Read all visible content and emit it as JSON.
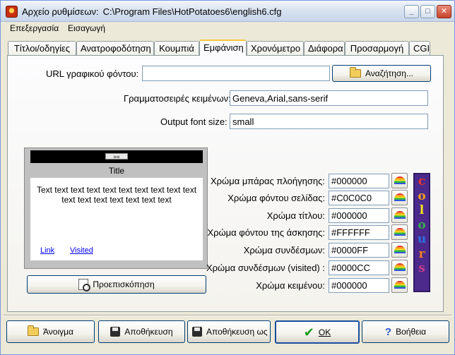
{
  "window": {
    "title": "Αρχείο ρυθμίσεων:",
    "path": "C:\\Program Files\\HotPotatoes6\\english6.cfg"
  },
  "menu": [
    "Επεξεργασία",
    "Εισαγωγή"
  ],
  "tabs": [
    {
      "label": "Τίτλοι/οδηγίες"
    },
    {
      "label": "Ανατροφοδότηση"
    },
    {
      "label": "Κουμπιά"
    },
    {
      "label": "Εμφάνιση",
      "active": true
    },
    {
      "label": "Χρονόμετρο"
    },
    {
      "label": "Διάφορα"
    },
    {
      "label": "Προσαρμογή"
    },
    {
      "label": "CGI"
    }
  ],
  "appearance": {
    "bg_url_label": "URL γραφικού φόντου:",
    "bg_url_value": "",
    "browse_label": "Αναζήτηση...",
    "fonts_label": "Γραμματοσειρές κειμένων:",
    "fonts_value": "Geneva,Arial,sans-serif",
    "font_size_label": "Output font size:",
    "font_size_value": "small"
  },
  "preview": {
    "nav_button": "==",
    "title": "Title",
    "text": "Text text text text text text text text text text text text text text text text text",
    "link": "Link",
    "visited": "Visited",
    "button_label": "Προεπισκόπηση"
  },
  "colours": [
    {
      "label": "Χρώμα μπάρας πλοήγησης:",
      "value": "#000000"
    },
    {
      "label": "Χρώμα φόντου σελίδας:",
      "value": "#C0C0C0"
    },
    {
      "label": "Χρώμα τίτλου:",
      "value": "#000000"
    },
    {
      "label": "Χρώμα φόντου της άσκησης:",
      "value": "#FFFFFF"
    },
    {
      "label": "Χρώμα συνδέσμων:",
      "value": "#0000FF"
    },
    {
      "label": "Χρώμα συνδέσμων (visited) :",
      "value": "#0000CC"
    },
    {
      "label": "Χρώμα κειμένου:",
      "value": "#000000"
    }
  ],
  "colours_word": [
    "c",
    "o",
    "l",
    "o",
    "u",
    "r",
    "s"
  ],
  "colours_word_colors": [
    "#e8352e",
    "#f4a11b",
    "#f5e51c",
    "#37b04a",
    "#2d6fe0",
    "#f07c1e",
    "#c43c8e"
  ],
  "footer": {
    "open": "Άνοιγμα",
    "save": "Αποθήκευση",
    "save_as": "Αποθήκευση ως",
    "ok": "OK",
    "help": "Βοήθεια"
  }
}
